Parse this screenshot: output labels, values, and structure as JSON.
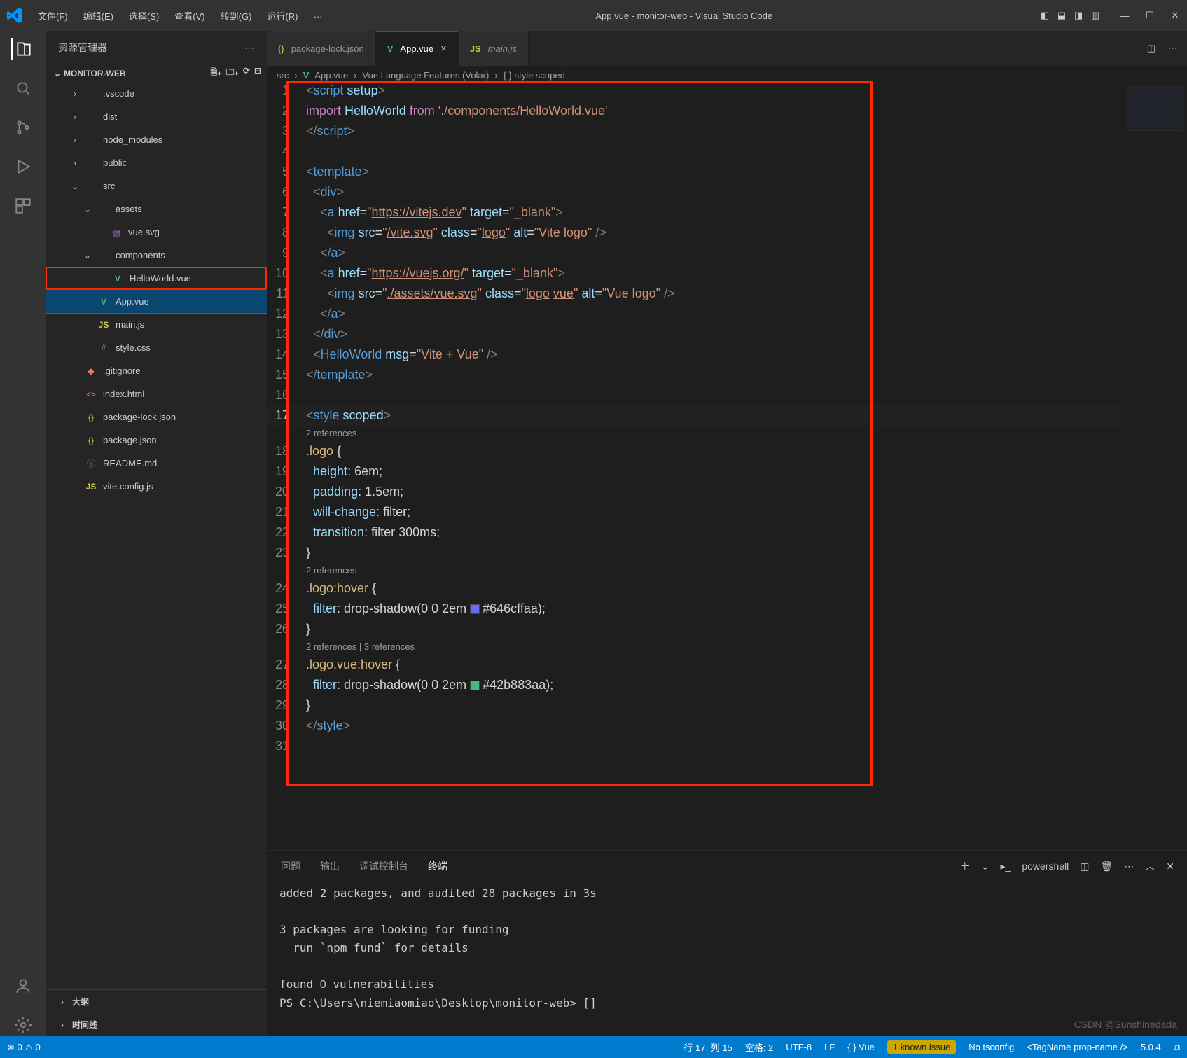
{
  "title": "App.vue - monitor-web - Visual Studio Code",
  "menu": [
    "文件(F)",
    "编辑(E)",
    "选择(S)",
    "查看(V)",
    "转到(G)",
    "运行(R)",
    "…"
  ],
  "sidebar": {
    "title": "资源管理器",
    "project": "MONITOR-WEB",
    "tree": [
      {
        "depth": 1,
        "chev": "›",
        "icon": "folder",
        "label": ".vscode"
      },
      {
        "depth": 1,
        "chev": "›",
        "icon": "folder",
        "label": "dist"
      },
      {
        "depth": 1,
        "chev": "›",
        "icon": "folder",
        "label": "node_modules"
      },
      {
        "depth": 1,
        "chev": "›",
        "icon": "folder",
        "label": "public"
      },
      {
        "depth": 1,
        "chev": "⌄",
        "icon": "folder",
        "label": "src"
      },
      {
        "depth": 2,
        "chev": "⌄",
        "icon": "folder",
        "label": "assets"
      },
      {
        "depth": 3,
        "chev": "",
        "icon": "svg",
        "label": "vue.svg"
      },
      {
        "depth": 2,
        "chev": "⌄",
        "icon": "folder",
        "label": "components"
      },
      {
        "depth": 3,
        "chev": "",
        "icon": "vue",
        "label": "HelloWorld.vue",
        "highlight": true
      },
      {
        "depth": 2,
        "chev": "",
        "icon": "vue",
        "label": "App.vue",
        "selected": true
      },
      {
        "depth": 2,
        "chev": "",
        "icon": "js",
        "label": "main.js"
      },
      {
        "depth": 2,
        "chev": "",
        "icon": "css",
        "label": "style.css"
      },
      {
        "depth": 1,
        "chev": "",
        "icon": "git",
        "label": ".gitignore"
      },
      {
        "depth": 1,
        "chev": "",
        "icon": "html",
        "label": "index.html"
      },
      {
        "depth": 1,
        "chev": "",
        "icon": "json",
        "label": "package-lock.json"
      },
      {
        "depth": 1,
        "chev": "",
        "icon": "json",
        "label": "package.json"
      },
      {
        "depth": 1,
        "chev": "",
        "icon": "md",
        "label": "README.md"
      },
      {
        "depth": 1,
        "chev": "",
        "icon": "js",
        "label": "vite.config.js"
      }
    ],
    "outline": "大纲",
    "timeline": "时间线"
  },
  "tabs": [
    {
      "icon": "json",
      "label": "package-lock.json",
      "active": false
    },
    {
      "icon": "vue",
      "label": "App.vue",
      "active": true,
      "close": "×"
    },
    {
      "icon": "js",
      "label": "main.js",
      "active": false,
      "italic": true
    }
  ],
  "breadcrumb": [
    "src",
    "App.vue",
    "Vue Language Features (Volar)",
    "{ } style scoped"
  ],
  "code": {
    "lines": [
      {
        "n": 1,
        "html": "<span class='c-pun'>&lt;</span><span class='c-tag'>script</span> <span class='c-attr'>setup</span><span class='c-pun'>&gt;</span>"
      },
      {
        "n": 2,
        "html": "<span class='c-key'>import</span> <span class='c-var'>HelloWorld</span> <span class='c-key'>from</span> <span class='c-str'>'./components/HelloWorld.vue'</span>"
      },
      {
        "n": 3,
        "html": "<span class='c-pun'>&lt;/</span><span class='c-tag'>script</span><span class='c-pun'>&gt;</span>"
      },
      {
        "n": 4,
        "html": ""
      },
      {
        "n": 5,
        "html": "<span class='c-pun'>&lt;</span><span class='c-tag'>template</span><span class='c-pun'>&gt;</span>"
      },
      {
        "n": 6,
        "html": "  <span class='c-pun'>&lt;</span><span class='c-tag'>div</span><span class='c-pun'>&gt;</span>"
      },
      {
        "n": 7,
        "html": "    <span class='c-pun'>&lt;</span><span class='c-tag'>a</span> <span class='c-attr'>href</span><span class='c-white'>=</span><span class='c-str'>\"</span><span class='c-link'>https://vitejs.dev</span><span class='c-str'>\"</span> <span class='c-attr'>target</span><span class='c-white'>=</span><span class='c-str'>\"_blank\"</span><span class='c-pun'>&gt;</span>"
      },
      {
        "n": 8,
        "html": "      <span class='c-pun'>&lt;</span><span class='c-tag'>img</span> <span class='c-attr'>src</span><span class='c-white'>=</span><span class='c-str'>\"</span><span class='c-link'>/vite.svg</span><span class='c-str'>\"</span> <span class='c-attr'>class</span><span class='c-white'>=</span><span class='c-str'>\"</span><span class='c-link'>logo</span><span class='c-str'>\"</span> <span class='c-attr'>alt</span><span class='c-white'>=</span><span class='c-str'>\"Vite logo\"</span> <span class='c-pun'>/&gt;</span>"
      },
      {
        "n": 9,
        "html": "    <span class='c-pun'>&lt;/</span><span class='c-tag'>a</span><span class='c-pun'>&gt;</span>"
      },
      {
        "n": 10,
        "html": "    <span class='c-pun'>&lt;</span><span class='c-tag'>a</span> <span class='c-attr'>href</span><span class='c-white'>=</span><span class='c-str'>\"</span><span class='c-link'>https://vuejs.org/</span><span class='c-str'>\"</span> <span class='c-attr'>target</span><span class='c-white'>=</span><span class='c-str'>\"_blank\"</span><span class='c-pun'>&gt;</span>"
      },
      {
        "n": 11,
        "html": "      <span class='c-pun'>&lt;</span><span class='c-tag'>img</span> <span class='c-attr'>src</span><span class='c-white'>=</span><span class='c-str'>\"</span><span class='c-link'>./assets/vue.svg</span><span class='c-str'>\"</span> <span class='c-attr'>class</span><span class='c-white'>=</span><span class='c-str'>\"</span><span class='c-link'>logo</span> <span class='c-link'>vue</span><span class='c-str'>\"</span> <span class='c-attr'>alt</span><span class='c-white'>=</span><span class='c-str'>\"Vue logo\"</span> <span class='c-pun'>/&gt;</span>"
      },
      {
        "n": 12,
        "html": "    <span class='c-pun'>&lt;/</span><span class='c-tag'>a</span><span class='c-pun'>&gt;</span>"
      },
      {
        "n": 13,
        "html": "  <span class='c-pun'>&lt;/</span><span class='c-tag'>div</span><span class='c-pun'>&gt;</span>"
      },
      {
        "n": 14,
        "html": "  <span class='c-pun'>&lt;</span><span class='c-tag'>HelloWorld</span> <span class='c-attr'>msg</span><span class='c-white'>=</span><span class='c-str'>\"Vite + Vue\"</span> <span class='c-pun'>/&gt;</span>"
      },
      {
        "n": 15,
        "html": "<span class='c-pun'>&lt;/</span><span class='c-tag'>template</span><span class='c-pun'>&gt;</span>"
      },
      {
        "n": 16,
        "html": ""
      },
      {
        "n": 17,
        "html": "<span class='c-pun'>&lt;</span><span class='c-tag'>style</span> <span class='c-attr'>scoped</span><span class='c-pun'>&gt;</span>",
        "cur": true
      },
      {
        "codelens": "2 references"
      },
      {
        "n": 18,
        "html": "<span class='c-sel'>.logo</span> <span class='c-white'>{</span>"
      },
      {
        "n": 19,
        "html": "  <span class='c-prop'>height</span><span class='c-white'>: 6em;</span>"
      },
      {
        "n": 20,
        "html": "  <span class='c-prop'>padding</span><span class='c-white'>: 1.5em;</span>"
      },
      {
        "n": 21,
        "html": "  <span class='c-prop'>will-change</span><span class='c-white'>: filter;</span>"
      },
      {
        "n": 22,
        "html": "  <span class='c-prop'>transition</span><span class='c-white'>: filter 300ms;</span>"
      },
      {
        "n": 23,
        "html": "<span class='c-white'>}</span>"
      },
      {
        "codelens": "2 references"
      },
      {
        "n": 24,
        "html": "<span class='c-sel'>.logo:hover</span> <span class='c-white'>{</span>"
      },
      {
        "n": 25,
        "html": "  <span class='c-prop'>filter</span><span class='c-white'>: drop-shadow(0 0 2em </span><span class='colorbox' style='background:#646cff'></span><span class='c-white'>#646cffaa);</span>"
      },
      {
        "n": 26,
        "html": "<span class='c-white'>}</span>"
      },
      {
        "codelens": "2 references | 3 references"
      },
      {
        "n": 27,
        "html": "<span class='c-sel'>.logo.vue:hover</span> <span class='c-white'>{</span>"
      },
      {
        "n": 28,
        "html": "  <span class='c-prop'>filter</span><span class='c-white'>: drop-shadow(0 0 2em </span><span class='colorbox' style='background:#42b883'></span><span class='c-white'>#42b883aa);</span>"
      },
      {
        "n": 29,
        "html": "<span class='c-white'>}</span>"
      },
      {
        "n": 30,
        "html": "<span class='c-pun'>&lt;/</span><span class='c-tag'>style</span><span class='c-pun'>&gt;</span>"
      },
      {
        "n": 31,
        "html": ""
      }
    ]
  },
  "panel": {
    "tabs": [
      "问题",
      "输出",
      "调试控制台",
      "终端"
    ],
    "active": 3,
    "shell": "powershell",
    "body": "added 2 packages, and audited 28 packages in 3s\n\n3 packages are looking for funding\n  run `npm fund` for details\n\nfound 0 vulnerabilities\nPS C:\\Users\\niemiaomiao\\Desktop\\monitor-web> []"
  },
  "status": {
    "left": "⊗ 0 ⚠ 0",
    "items": [
      "行 17, 列 15",
      "空格: 2",
      "UTF-8",
      "LF",
      "{ } Vue"
    ],
    "warn": "1 known issue",
    "right": [
      "No tsconfig",
      "<TagName prop-name />",
      "5.0.4",
      "⧉"
    ]
  },
  "watermark": "CSDN @Sunshinedada"
}
